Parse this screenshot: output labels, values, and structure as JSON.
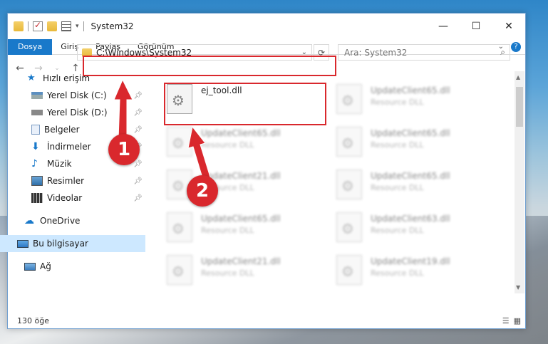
{
  "window": {
    "title": "System32"
  },
  "ribbon": {
    "tabs": [
      "Dosya",
      "Giriş",
      "Paylaş",
      "Görünüm"
    ]
  },
  "address": {
    "path": "C:\\Windows\\System32"
  },
  "search": {
    "placeholder": "Ara: System32"
  },
  "sidebar": {
    "items": [
      {
        "label": "Hızlı erişim",
        "icon": "star-icon"
      },
      {
        "label": "Yerel Disk (C:)",
        "icon": "drive-icon"
      },
      {
        "label": "Yerel Disk (D:)",
        "icon": "drive-icon"
      },
      {
        "label": "Belgeler",
        "icon": "document-icon"
      },
      {
        "label": "İndirmeler",
        "icon": "download-icon"
      },
      {
        "label": "Müzik",
        "icon": "music-icon"
      },
      {
        "label": "Resimler",
        "icon": "pictures-icon"
      },
      {
        "label": "Videolar",
        "icon": "video-icon"
      },
      {
        "label": "OneDrive",
        "icon": "cloud-icon"
      },
      {
        "label": "Bu bilgisayar",
        "icon": "computer-icon"
      },
      {
        "label": "Ağ",
        "icon": "network-icon"
      }
    ]
  },
  "files": [
    {
      "name": "ej_tool.dll",
      "desc": ""
    },
    {
      "name": "UpdateClient65.dll",
      "desc": "Resource DLL"
    },
    {
      "name": "UpdateClient65.dll",
      "desc": "Resource DLL"
    },
    {
      "name": "UpdateClient65.dll",
      "desc": "Resource DLL"
    },
    {
      "name": "UpdateClient21.dll",
      "desc": "Resource DLL"
    },
    {
      "name": "UpdateClient65.dll",
      "desc": "Resource DLL"
    },
    {
      "name": "UpdateClient65.dll",
      "desc": "Resource DLL"
    },
    {
      "name": "UpdateClient63.dll",
      "desc": "Resource DLL"
    },
    {
      "name": "UpdateClient21.dll",
      "desc": "Resource DLL"
    },
    {
      "name": "UpdateClient19.dll",
      "desc": "Resource DLL"
    }
  ],
  "status": {
    "count": "130 öğe"
  },
  "markers": [
    "1",
    "2"
  ],
  "colors": {
    "accent": "#1979ca",
    "highlight": "#d9282d",
    "selected": "#cde8ff"
  }
}
